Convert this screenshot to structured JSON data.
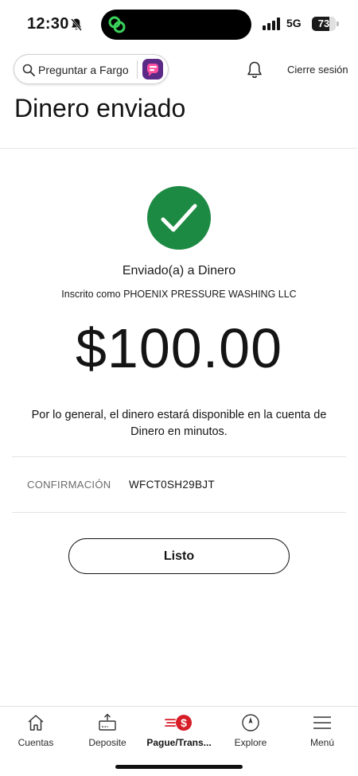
{
  "status_bar": {
    "time": "12:30",
    "network": "5G",
    "battery": "73",
    "battery_level": 0.73
  },
  "header": {
    "search_label": "Preguntar a Fargo",
    "signout_label": "Cierre sesión",
    "page_title": "Dinero enviado"
  },
  "confirmation": {
    "sent_to": "Enviado(a) a Dinero",
    "enrolled_as": "Inscrito como PHOENIX PRESSURE WASHING LLC",
    "amount": "$100.00",
    "availability_note": "Por lo general, el dinero estará disponible en la cuenta de Dinero en minutos.",
    "confirmation_label": "CONFIRMACIÓN",
    "confirmation_code": "WFCT0SH29BJT",
    "done_label": "Listo"
  },
  "bottom_nav": {
    "items": [
      {
        "label": "Cuentas",
        "icon": "home-icon"
      },
      {
        "label": "Deposite",
        "icon": "deposit-icon"
      },
      {
        "label": "Pague/Trans...",
        "icon": "pay-transfer-icon",
        "active": true
      },
      {
        "label": "Explore",
        "icon": "compass-icon"
      },
      {
        "label": "Menú",
        "icon": "menu-icon"
      }
    ]
  },
  "colors": {
    "success_green": "#1d8a43",
    "fargo_purple": "#5b2a86",
    "pay_badge_red": "#d71e28"
  }
}
